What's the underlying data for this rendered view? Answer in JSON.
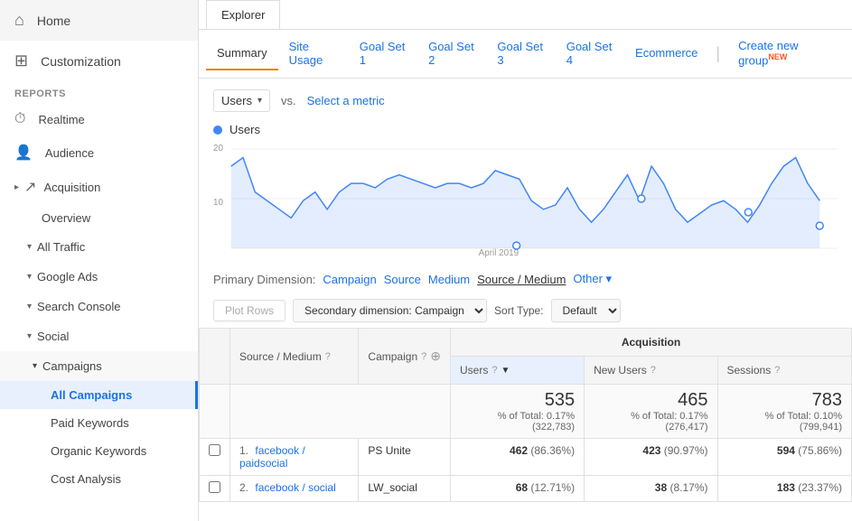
{
  "sidebar": {
    "home_label": "Home",
    "customization_label": "Customization",
    "reports_label": "REPORTS",
    "realtime_label": "Realtime",
    "audience_label": "Audience",
    "acquisition_label": "Acquisition",
    "overview_label": "Overview",
    "all_traffic_label": "All Traffic",
    "google_ads_label": "Google Ads",
    "search_console_label": "Search Console",
    "social_label": "Social",
    "campaigns_label": "Campaigns",
    "all_campaigns_label": "All Campaigns",
    "paid_keywords_label": "Paid Keywords",
    "organic_keywords_label": "Organic Keywords",
    "cost_analysis_label": "Cost Analysis"
  },
  "tabs": {
    "explorer_label": "Explorer",
    "summary_label": "Summary",
    "site_usage_label": "Site Usage",
    "goal_set_1_label": "Goal Set 1",
    "goal_set_2_label": "Goal Set 2",
    "goal_set_3_label": "Goal Set 3",
    "goal_set_4_label": "Goal Set 4",
    "ecommerce_label": "Ecommerce",
    "create_new_group_label": "Create new group",
    "new_badge": "NEW"
  },
  "metric_selector": {
    "metric_label": "Users",
    "vs_label": "vs.",
    "select_metric_label": "Select a metric"
  },
  "chart": {
    "legend_label": "Users",
    "y_max": "20",
    "y_mid": "10",
    "x_label": "April 2019",
    "points": [
      18,
      20,
      12,
      10,
      8,
      6,
      10,
      12,
      8,
      12,
      14,
      14,
      13,
      15,
      16,
      15,
      14,
      13,
      14,
      14,
      13,
      14,
      17,
      16,
      15,
      10,
      8,
      9,
      13,
      8,
      5,
      8,
      12,
      16,
      10,
      18,
      14,
      8,
      5,
      7,
      9,
      10,
      8,
      5,
      9,
      14,
      18,
      20,
      14,
      10
    ]
  },
  "primary_dimension": {
    "label": "Primary Dimension:",
    "campaign": "Campaign",
    "source": "Source",
    "medium": "Medium",
    "source_medium": "Source / Medium",
    "other": "Other"
  },
  "table_controls": {
    "plot_rows_label": "Plot Rows",
    "secondary_dim_label": "Secondary dimension: Campaign",
    "sort_type_label": "Sort Type:",
    "sort_default_label": "Default"
  },
  "table": {
    "headers": {
      "checkbox": "",
      "source_medium": "Source / Medium",
      "campaign": "Campaign",
      "acquisition_group": "Acquisition",
      "users": "Users",
      "new_users": "New Users",
      "sessions": "Sessions"
    },
    "total": {
      "users_value": "535",
      "users_pct": "% of Total: 0.17% (322,783)",
      "new_users_value": "465",
      "new_users_pct": "% of Total: 0.17% (276,417)",
      "sessions_value": "783",
      "sessions_pct": "% of Total: 0.10% (799,941)"
    },
    "rows": [
      {
        "num": "1.",
        "source_medium": "facebook / paidsocial",
        "campaign": "PS Unite",
        "users": "462",
        "users_pct": "(86.36%)",
        "new_users": "423",
        "new_users_pct": "(90.97%)",
        "sessions": "594",
        "sessions_pct": "(75.86%)"
      },
      {
        "num": "2.",
        "source_medium": "facebook / social",
        "campaign": "LW_social",
        "users": "68",
        "users_pct": "(12.71%)",
        "new_users": "38",
        "new_users_pct": "(8.17%)",
        "sessions": "183",
        "sessions_pct": "(23.37%)"
      }
    ]
  }
}
